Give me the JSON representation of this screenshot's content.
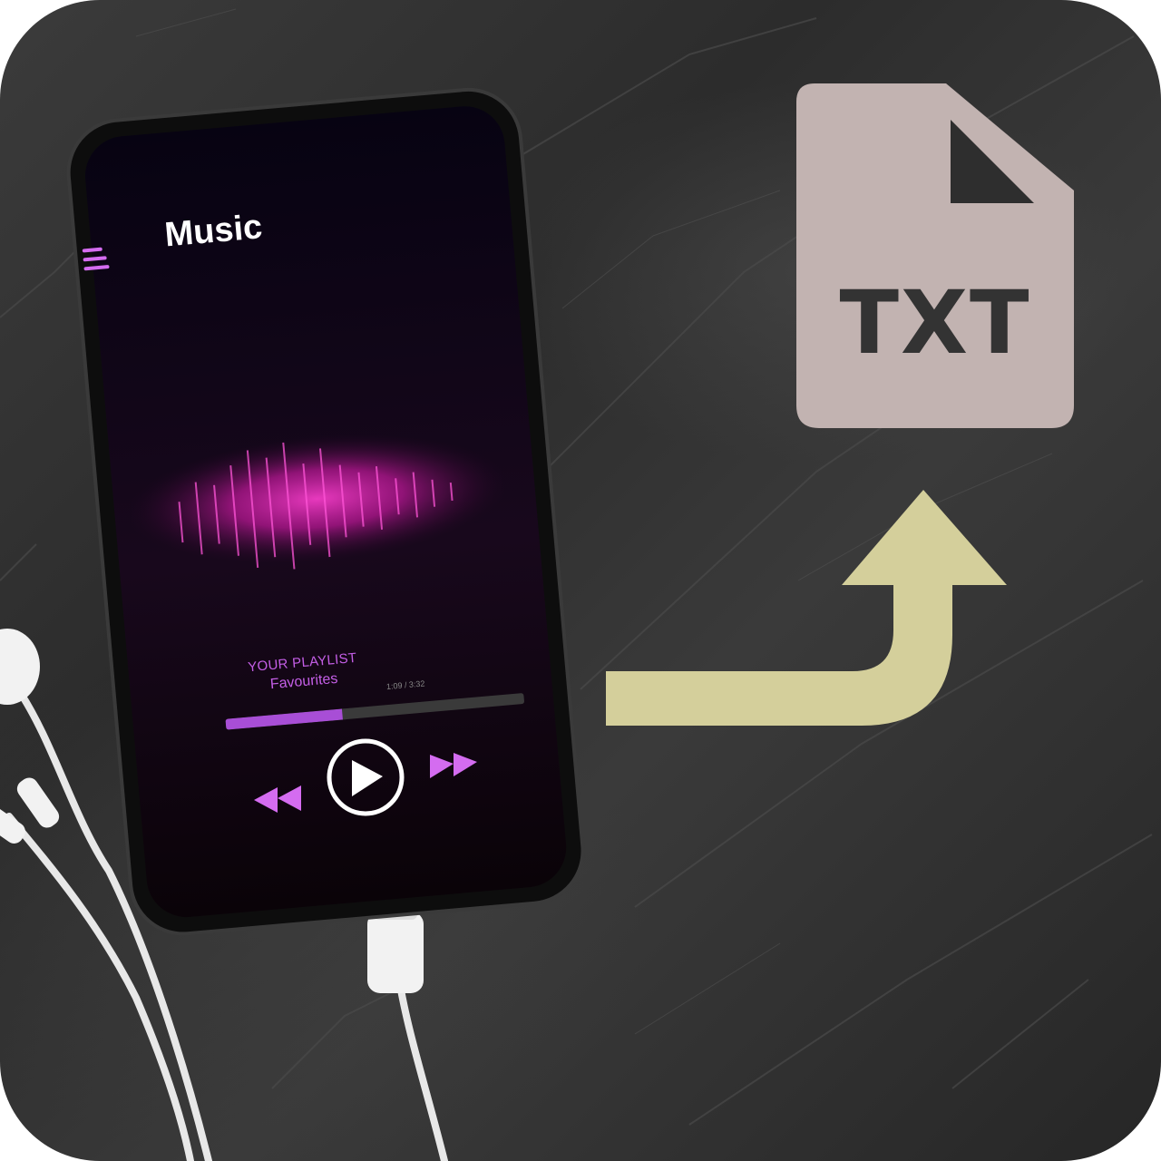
{
  "music_app": {
    "title": "Music",
    "menu_icon": "hamburger-menu-icon",
    "playlist_label": "YOUR PLAYLIST",
    "playlist_name": "Favourites",
    "time_readout": "1:09 / 3:32",
    "progress": 0.39,
    "controls": {
      "rewind_icon": "rewind-icon",
      "play_icon": "play-icon",
      "forward_icon": "fast-forward-icon"
    }
  },
  "file_icon": {
    "label": "TXT",
    "icon": "file-document-icon"
  },
  "colors": {
    "accent_purple": "#c45ee6",
    "file_icon_fill": "#c2b3b1",
    "arrow_fill": "#d4cf9b",
    "stone_background": "#303030"
  }
}
